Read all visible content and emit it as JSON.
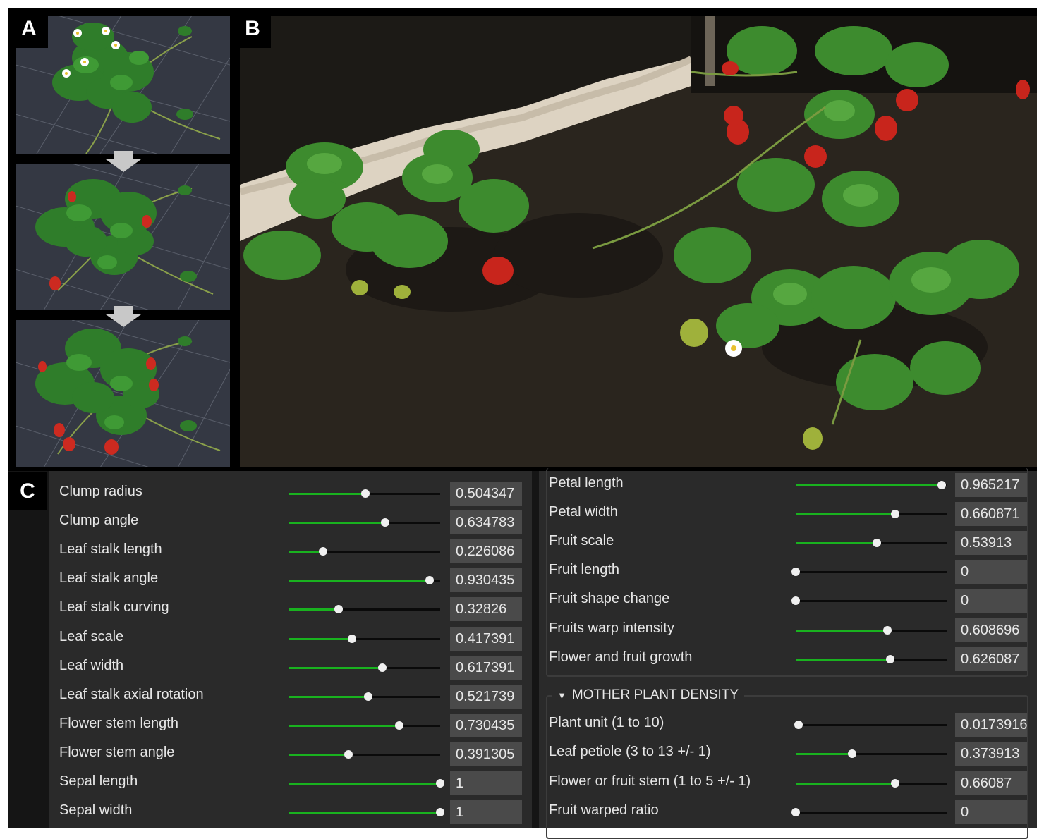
{
  "panel_labels": {
    "a": "A",
    "b": "B",
    "c": "C"
  },
  "left_params": [
    {
      "label": "Clump radius",
      "value": "0.504347",
      "level": 0.504347
    },
    {
      "label": "Clump angle",
      "value": "0.634783",
      "level": 0.634783
    },
    {
      "label": "Leaf stalk length",
      "value": "0.226086",
      "level": 0.226086
    },
    {
      "label": "Leaf stalk angle",
      "value": "0.930435",
      "level": 0.930435
    },
    {
      "label": "Leaf stalk curving",
      "value": "0.32826",
      "level": 0.32826
    },
    {
      "label": "Leaf scale",
      "value": "0.417391",
      "level": 0.417391
    },
    {
      "label": "Leaf width",
      "value": "0.617391",
      "level": 0.617391
    },
    {
      "label": "Leaf stalk axial rotation",
      "value": "0.521739",
      "level": 0.521739
    },
    {
      "label": "Flower stem length",
      "value": "0.730435",
      "level": 0.730435
    },
    {
      "label": "Flower stem angle",
      "value": "0.391305",
      "level": 0.391305
    },
    {
      "label": "Sepal length",
      "value": "1",
      "level": 1
    },
    {
      "label": "Sepal width",
      "value": "1",
      "level": 1
    }
  ],
  "right_params": [
    {
      "label": "Petal length",
      "value": "0.965217",
      "level": 0.965217
    },
    {
      "label": "Petal width",
      "value": "0.660871",
      "level": 0.660871
    },
    {
      "label": "Fruit scale",
      "value": "0.53913",
      "level": 0.53913
    },
    {
      "label": "Fruit length",
      "value": "0",
      "level": 0
    },
    {
      "label": "Fruit shape change",
      "value": "0",
      "level": 0
    },
    {
      "label": "Fruits warp intensity",
      "value": "0.608696",
      "level": 0.608696
    },
    {
      "label": "Flower and fruit growth",
      "value": "0.626087",
      "level": 0.626087
    }
  ],
  "mother_section": {
    "title": "MOTHER PLANT DENSITY",
    "params": [
      {
        "label": "Plant unit (1 to 10)",
        "value": "0.0173916",
        "level": 0.0173916
      },
      {
        "label": "Leaf petiole (3 to 13 +/- 1)",
        "value": "0.373913",
        "level": 0.373913
      },
      {
        "label": "Flower or fruit stem (1 to 5 +/- 1)",
        "value": "0.66087",
        "level": 0.66087
      },
      {
        "label": "Fruit warped ratio",
        "value": "0",
        "level": 0
      }
    ]
  },
  "colors": {
    "slider_fill": "#19b21f",
    "panel_bg": "#2a2a2a",
    "value_box": "#4a4a4a"
  }
}
